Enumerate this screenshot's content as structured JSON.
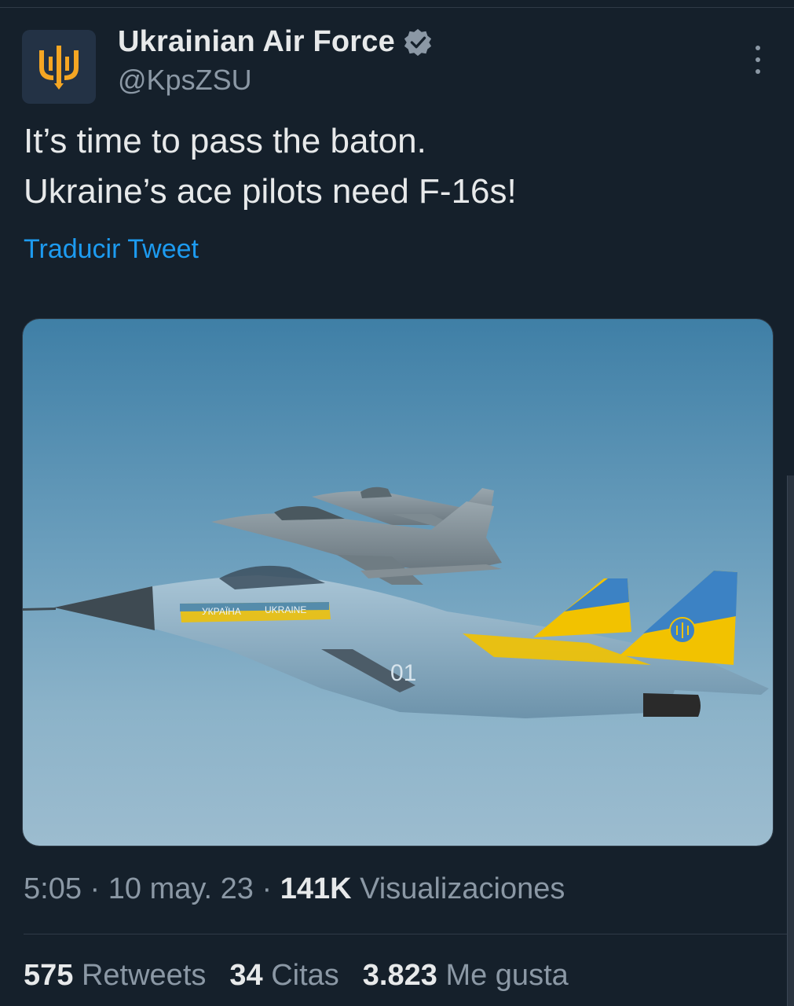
{
  "author": {
    "name": "Ukrainian Air Force",
    "handle": "@KpsZSU"
  },
  "tweet": {
    "lines": [
      "It’s time to pass the baton.",
      "Ukraine’s ace pilots need F-16s!"
    ],
    "translate_label": "Traducir Tweet"
  },
  "meta": {
    "time": "5:05",
    "separator": " · ",
    "date": "10 may. 23",
    "views_count": "141K",
    "views_label": "Visualizaciones"
  },
  "stats": {
    "retweets_count": "575",
    "retweets_label": "Retweets",
    "quotes_count": "34",
    "quotes_label": "Citas",
    "likes_count": "3.823",
    "likes_label": "Me gusta"
  },
  "media": {
    "fuselage_text_1": "УКРАЇНА",
    "fuselage_text_2": "UKRAINE",
    "tail_number": "01"
  },
  "colors": {
    "background": "#15202b",
    "accent": "#1d9bf0",
    "verified": "#8b98a5",
    "logo": "#f5a623"
  },
  "icons": [
    "trident-logo-icon",
    "verified-badge-icon",
    "more-options-icon"
  ]
}
